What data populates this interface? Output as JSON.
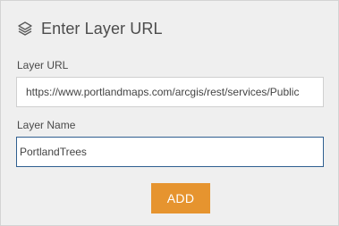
{
  "header": {
    "title": "Enter Layer URL",
    "icon": "layers-icon"
  },
  "layer_url": {
    "label": "Layer URL",
    "value": "https://www.portlandmaps.com/arcgis/rest/services/Public"
  },
  "layer_name": {
    "label": "Layer Name",
    "value": "PortlandTrees"
  },
  "actions": {
    "add_label": "ADD"
  },
  "colors": {
    "accent": "#e6942f",
    "focus_border": "#2f5f90",
    "panel_background": "#efefef"
  }
}
